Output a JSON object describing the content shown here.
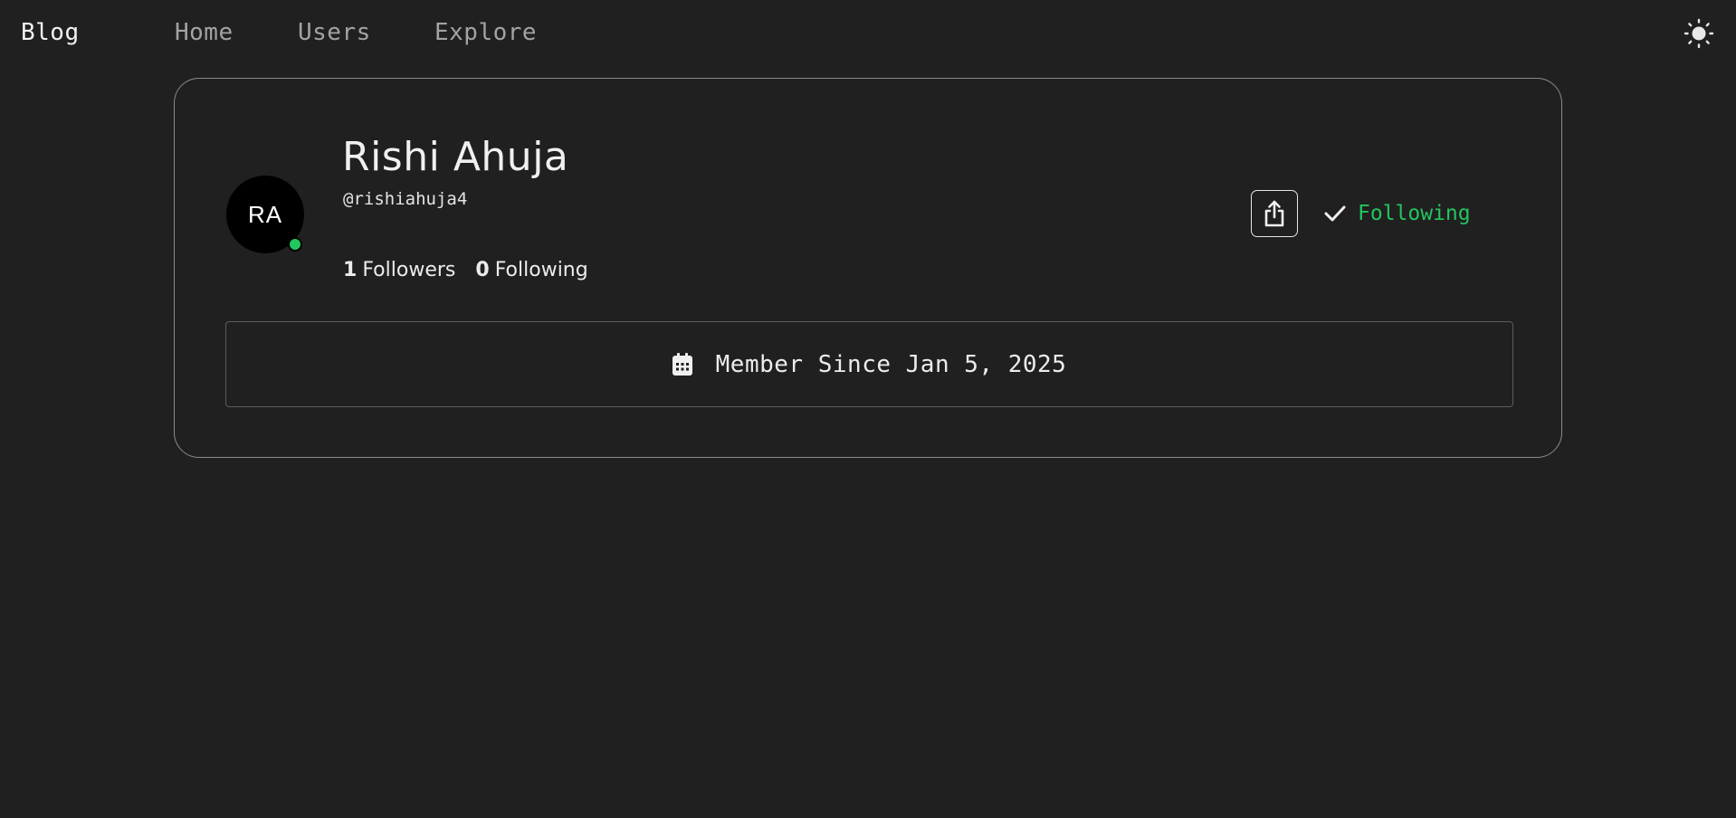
{
  "nav": {
    "brand": "Blog",
    "links": [
      {
        "label": "Home"
      },
      {
        "label": "Users"
      },
      {
        "label": "Explore"
      }
    ],
    "theme_toggle_icon": "sun-icon"
  },
  "profile": {
    "initials": "RA",
    "name": "Rishi Ahuja",
    "handle": "@rishiahuja4",
    "online_status_color": "#22c55e",
    "stats": {
      "followers_count": "1",
      "followers_label": "Followers",
      "following_count": "0",
      "following_label": "Following"
    },
    "actions": {
      "share_icon": "share-icon",
      "follow_icon": "check-icon",
      "follow_label": "Following",
      "follow_color": "#22c55e"
    },
    "member_since": {
      "icon": "calendar-icon",
      "text": "Member Since Jan 5, 2025"
    }
  },
  "theme": {
    "background": "#202020",
    "accent": "#22c55e"
  }
}
